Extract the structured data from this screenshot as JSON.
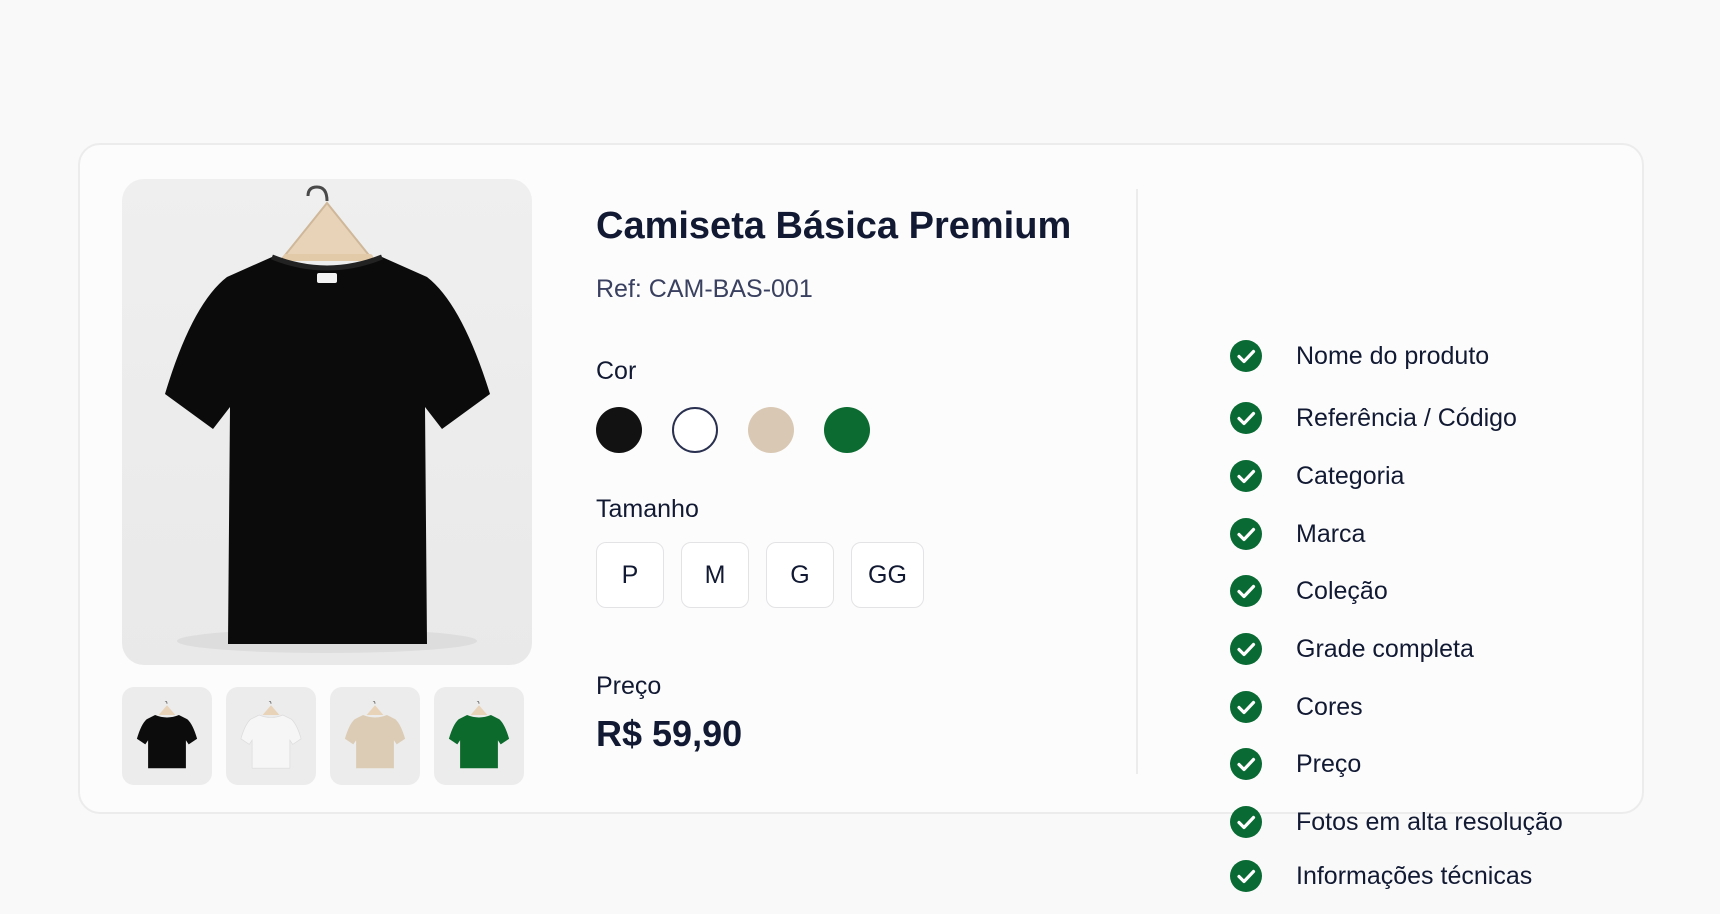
{
  "product": {
    "title": "Camiseta Básica Premium",
    "ref": "Ref: CAM-BAS-001",
    "color_label": "Cor",
    "colors": [
      {
        "name": "Preto",
        "hex": "#121212"
      },
      {
        "name": "Branco",
        "hex": "#ffffff"
      },
      {
        "name": "Bege",
        "hex": "#d9c8b4"
      },
      {
        "name": "Verde",
        "hex": "#0b6b30"
      }
    ],
    "size_label": "Tamanho",
    "sizes": [
      "P",
      "M",
      "G",
      "GG"
    ],
    "price_label": "Preço",
    "price": "R$ 59,90"
  },
  "gallery": {
    "thumbnails": [
      {
        "color": "#0c0c0c"
      },
      {
        "color": "#f6f6f6"
      },
      {
        "color": "#dcccb5"
      },
      {
        "color": "#0c6a2c"
      }
    ]
  },
  "checklist": {
    "accent": "#0a6a34",
    "items": [
      "Nome do produto",
      "Referência / Código",
      "Categoria",
      "Marca",
      "Coleção",
      "Grade completa",
      "Cores",
      "Preço",
      "Fotos em alta resolução",
      "Informações técnicas"
    ]
  }
}
